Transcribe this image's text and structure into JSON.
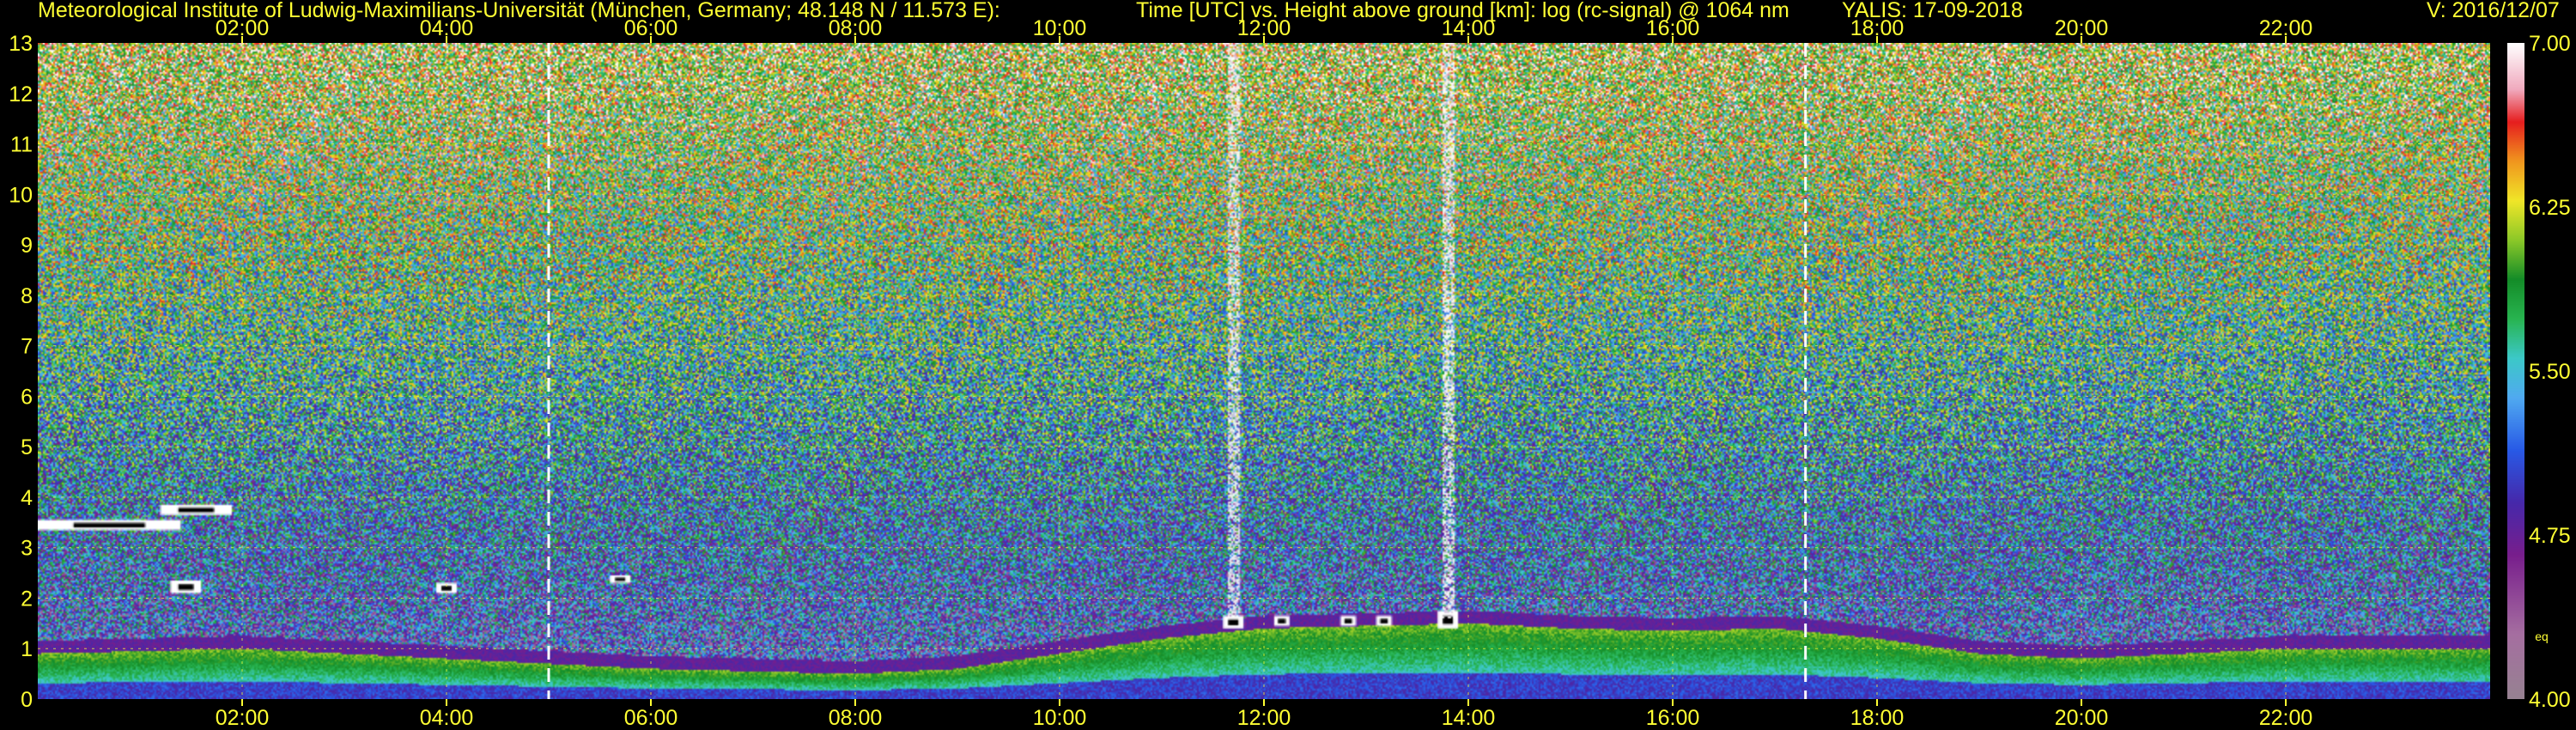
{
  "header": {
    "institute": "Meteorological Institute of Ludwig-Maximilians-Universität (München, Germany; 48.148 N / 11.573 E):",
    "description": "Time [UTC] vs. Height above ground [km]: log (rc-signal) @ 1064 nm",
    "station_date": "YALIS: 17-09-2018",
    "version": "V: 2016/12/07"
  },
  "colors": {
    "background": "#000000",
    "header_text": "#ffff33",
    "tick_text": "#ffff33",
    "grid": "#ffff33",
    "day_boundary_lines": "#ffffff"
  },
  "colorbar": {
    "min": 4.0,
    "max": 7.0,
    "labels": [
      "7.00",
      "6.25",
      "5.50",
      "4.75",
      "4.00"
    ],
    "unit_label": "eq"
  },
  "chart_data": {
    "type": "heatmap",
    "title": "Time [UTC] vs. Height above ground [km]: log (rc-signal) @ 1064 nm",
    "xlabel": "",
    "ylabel": "",
    "x_range_utc_hours": [
      0,
      24
    ],
    "ylim_km": [
      0,
      13
    ],
    "x_tick_labels": [
      "02:00",
      "04:00",
      "06:00",
      "08:00",
      "10:00",
      "12:00",
      "14:00",
      "16:00",
      "18:00",
      "20:00",
      "22:00"
    ],
    "y_tick_labels": [
      "0",
      "1",
      "2",
      "3",
      "4",
      "5",
      "6",
      "7",
      "8",
      "9",
      "10",
      "11",
      "12",
      "13"
    ],
    "grid": true,
    "vertical_markers_utc": [
      5.0,
      17.3
    ],
    "colorscale": {
      "label": "log (rc-signal)",
      "range": [
        4.0,
        7.0
      ],
      "legend_position": "right"
    },
    "boundary_layer_top_km": [
      {
        "x": 0.0,
        "y": 0.9
      },
      {
        "x": 1.0,
        "y": 0.95
      },
      {
        "x": 2.0,
        "y": 1.0
      },
      {
        "x": 3.0,
        "y": 0.9
      },
      {
        "x": 4.0,
        "y": 0.8
      },
      {
        "x": 5.0,
        "y": 0.7
      },
      {
        "x": 6.0,
        "y": 0.6
      },
      {
        "x": 7.0,
        "y": 0.55
      },
      {
        "x": 8.0,
        "y": 0.5
      },
      {
        "x": 9.0,
        "y": 0.6
      },
      {
        "x": 10.0,
        "y": 0.9
      },
      {
        "x": 11.0,
        "y": 1.2
      },
      {
        "x": 12.0,
        "y": 1.4
      },
      {
        "x": 13.0,
        "y": 1.45
      },
      {
        "x": 14.0,
        "y": 1.5
      },
      {
        "x": 15.0,
        "y": 1.4
      },
      {
        "x": 16.0,
        "y": 1.35
      },
      {
        "x": 17.0,
        "y": 1.4
      },
      {
        "x": 18.0,
        "y": 1.2
      },
      {
        "x": 19.0,
        "y": 0.9
      },
      {
        "x": 20.0,
        "y": 0.8
      },
      {
        "x": 21.0,
        "y": 0.9
      },
      {
        "x": 22.0,
        "y": 1.0
      },
      {
        "x": 23.0,
        "y": 1.0
      },
      {
        "x": 24.0,
        "y": 1.0
      }
    ],
    "clouds": [
      {
        "x_start": 0.0,
        "x_end": 1.4,
        "y_bottom": 3.35,
        "y_top": 3.55
      },
      {
        "x_start": 1.2,
        "x_end": 1.9,
        "y_bottom": 3.65,
        "y_top": 3.85
      },
      {
        "x_start": 1.3,
        "x_end": 1.6,
        "y_bottom": 2.1,
        "y_top": 2.35
      },
      {
        "x_start": 5.6,
        "x_end": 5.8,
        "y_bottom": 2.3,
        "y_top": 2.45
      },
      {
        "x_start": 3.9,
        "x_end": 4.1,
        "y_bottom": 2.1,
        "y_top": 2.3
      },
      {
        "x_start": 11.6,
        "x_end": 11.8,
        "y_bottom": 1.4,
        "y_top": 1.65
      },
      {
        "x_start": 12.1,
        "x_end": 12.25,
        "y_bottom": 1.45,
        "y_top": 1.65
      },
      {
        "x_start": 12.75,
        "x_end": 12.9,
        "y_bottom": 1.45,
        "y_top": 1.65
      },
      {
        "x_start": 13.1,
        "x_end": 13.25,
        "y_bottom": 1.45,
        "y_top": 1.65
      },
      {
        "x_start": 13.7,
        "x_end": 13.9,
        "y_bottom": 1.4,
        "y_top": 1.75
      }
    ],
    "precipitation_streaks": [
      {
        "x": 11.7,
        "y_top": 13.0
      },
      {
        "x": 13.8,
        "y_top": 13.0
      }
    ]
  }
}
